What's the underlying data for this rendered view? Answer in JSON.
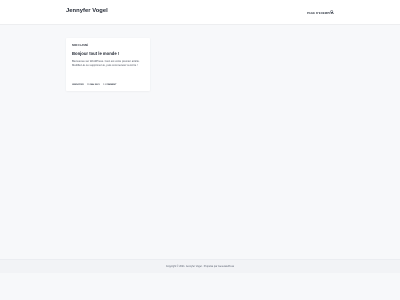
{
  "header": {
    "site_title": "Jennyfer Vogel",
    "nav_link": "PAGE D'EXEMPLE"
  },
  "post": {
    "category": "NON CLASSÉ",
    "title": "Bonjour tout le monde !",
    "excerpt": "Bienvenue sur WordPress. Ceci est votre premier article. Modifiez-le ou supprimez-le, puis commencez à écrire !",
    "meta": {
      "author": "JENNYFER",
      "date": "11 MAI 2021",
      "comments": "1 COMMENT"
    }
  },
  "footer": {
    "text": "Copyright © 2021. Jennyfer Vogel · Propulsé par GeneratePress"
  }
}
